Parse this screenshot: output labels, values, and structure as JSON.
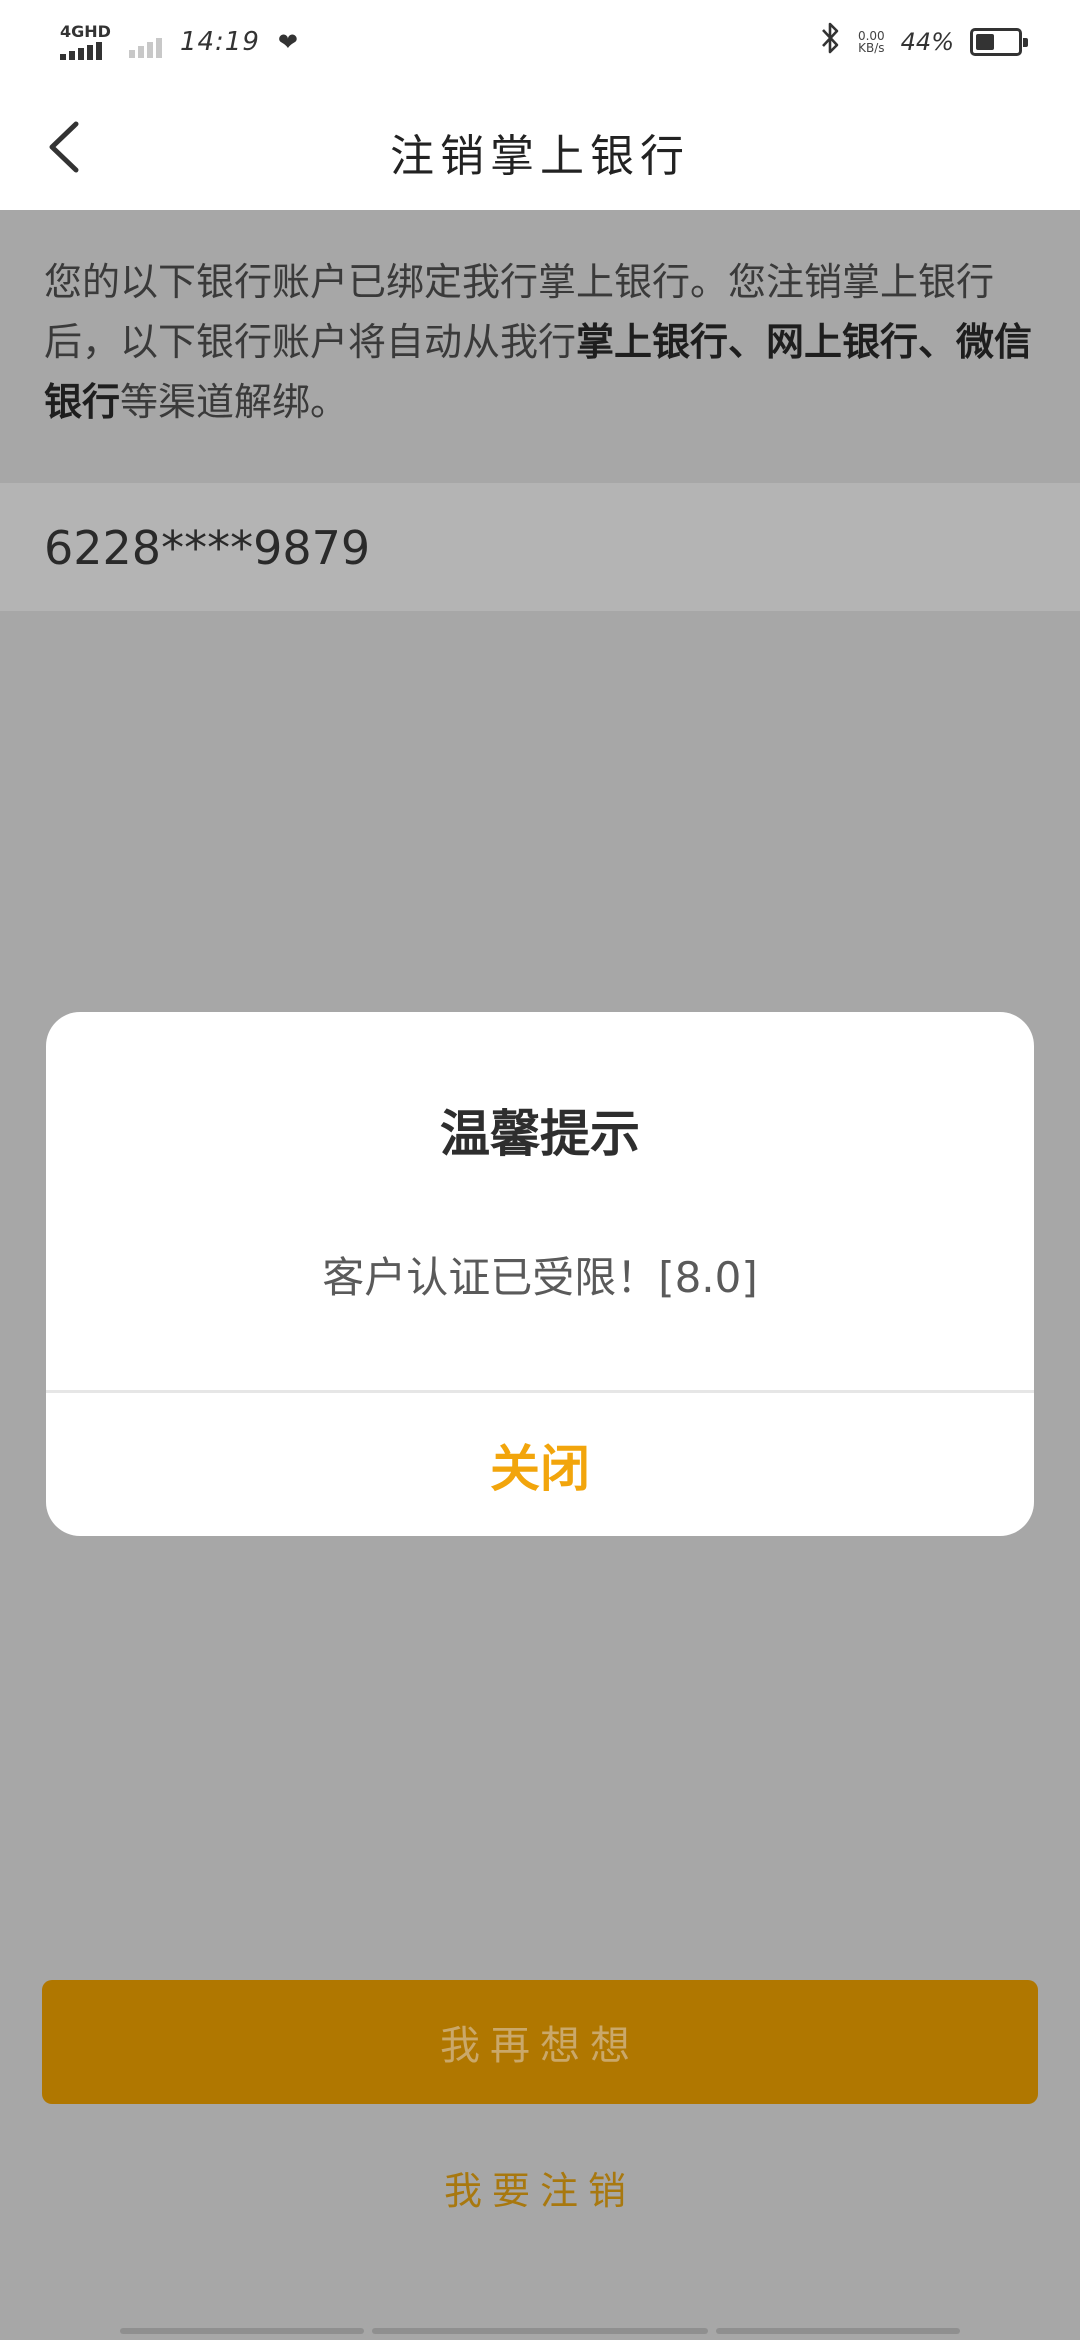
{
  "status_bar": {
    "network": "4GHD",
    "time": "14:19",
    "net_speed_value": "0.00",
    "net_speed_unit": "KB/s",
    "battery_pct": "44%",
    "battery_level": 0.44
  },
  "header": {
    "title": "注销掌上银行"
  },
  "notice": {
    "part1": "您的以下银行账户已绑定我行掌上银行。您注销掌上银行后，以下银行账户将自动从我行",
    "bold": "掌上银行、网上银行、微信银行",
    "part2": "等渠道解绑。"
  },
  "account": {
    "number": "6228****9879"
  },
  "dialog": {
    "title": "温馨提示",
    "message": "客户认证已受限！[8.0]",
    "close_label": "关闭"
  },
  "actions": {
    "rethink_label": "我再想想",
    "cancel_label": "我要注销"
  },
  "colors": {
    "accent": "#f2a50c",
    "button_dimmed": "#b07700",
    "overlay": "#a7a7a7"
  }
}
